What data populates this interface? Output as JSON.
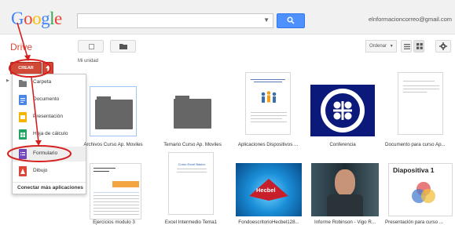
{
  "topbar": {
    "logo": "Google",
    "search_placeholder": "",
    "user_email": "elnformacioncorreo@gmail.com"
  },
  "drive": {
    "title": "Drive",
    "order_label": "Ordenar",
    "breadcrumb": "Mi unidad"
  },
  "create_button": {
    "label": "CREAR"
  },
  "create_menu": {
    "items": [
      {
        "label": "Carpeta",
        "icon": "folder-icon"
      },
      {
        "label": "Documento",
        "icon": "document-icon"
      },
      {
        "label": "Presentación",
        "icon": "presentation-icon"
      },
      {
        "label": "Hoja de cálculo",
        "icon": "spreadsheet-icon"
      },
      {
        "label": "Formulario",
        "icon": "form-icon"
      },
      {
        "label": "Dibujo",
        "icon": "drawing-icon"
      }
    ],
    "footer": "Conectar más aplicaciones"
  },
  "files": [
    {
      "name": "Archivos Curso Ap. Moviles",
      "type": "folder"
    },
    {
      "name": "Temario Curso Ap. Moviles",
      "type": "folder"
    },
    {
      "name": "Aplicaciones Dispositivos ...",
      "type": "document"
    },
    {
      "name": "Conferencia",
      "type": "image"
    },
    {
      "name": "Documento para curso Ap...",
      "type": "document"
    },
    {
      "name": "Ejercicios modulo 3",
      "type": "spreadsheet"
    },
    {
      "name": "Excel Intermedio Tema1",
      "type": "document"
    },
    {
      "name": "FondoescritorioHecbel128...",
      "type": "image",
      "thumb_text": "Hecbel"
    },
    {
      "name": "Informe Robinson - Vigo R...",
      "type": "video"
    },
    {
      "name": "Presentación para curso ...",
      "type": "presentation",
      "thumb_text": "Diapositiva 1"
    }
  ],
  "doc_thumb_title": "Curso Excel Básico",
  "colors": {
    "accent_red": "#dd4b39",
    "create_red": "#d14836",
    "search_blue": "#4d90fe",
    "annotation_red": "#d62020"
  }
}
